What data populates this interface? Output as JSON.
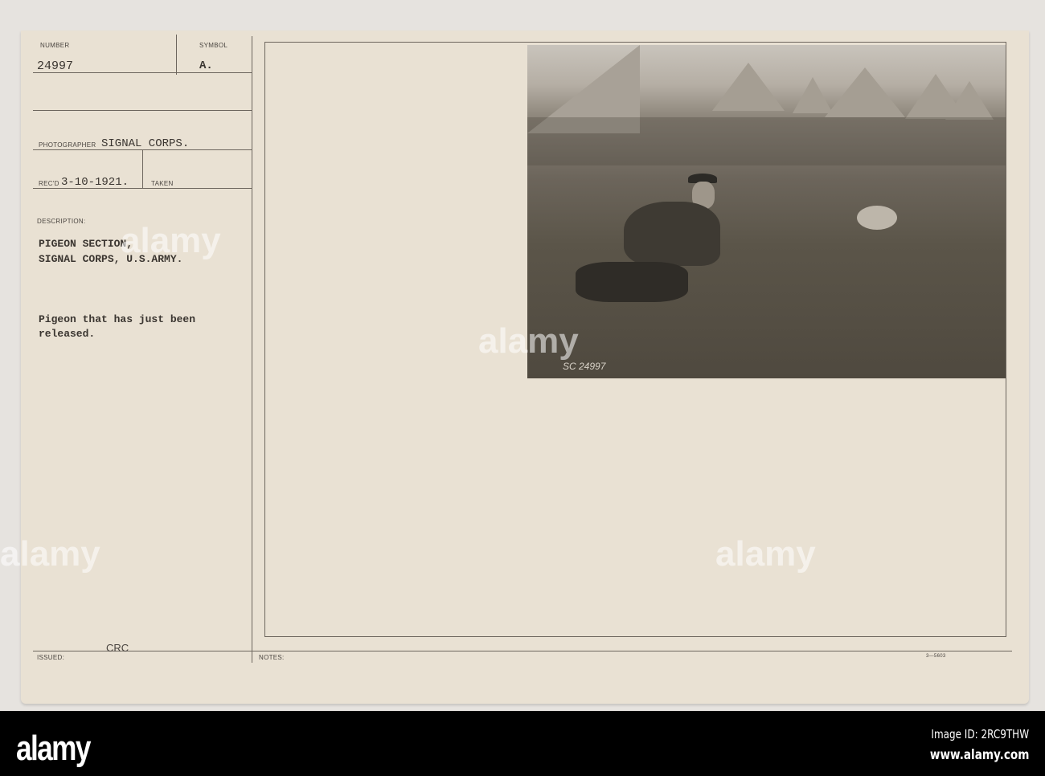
{
  "card": {
    "number_label": "NUMBER",
    "number_value": "24997",
    "symbol_label": "SYMBOL",
    "symbol_value": "A.",
    "photographer_label": "PHOTOGRAPHER",
    "photographer_value": "SIGNAL CORPS.",
    "recd_label": "REC'D",
    "recd_value": "3-10-1921.",
    "taken_label": "TAKEN",
    "description_label": "DESCRIPTION:",
    "description_line1": "PIGEON SECTION,",
    "description_line2": "SIGNAL CORPS, U.S.ARMY.",
    "caption_line1": "Pigeon that has just been",
    "caption_line2": "released.",
    "issued_label": "ISSUED:",
    "issued_value": "CRC",
    "notes_label": "NOTES:",
    "form_number": "3—5603"
  },
  "photo": {
    "negative_number": "SC 24997"
  },
  "footer": {
    "logo": "alamy",
    "image_id": "Image ID: 2RC9THW",
    "url": "www.alamy.com"
  },
  "watermark": "alamy"
}
